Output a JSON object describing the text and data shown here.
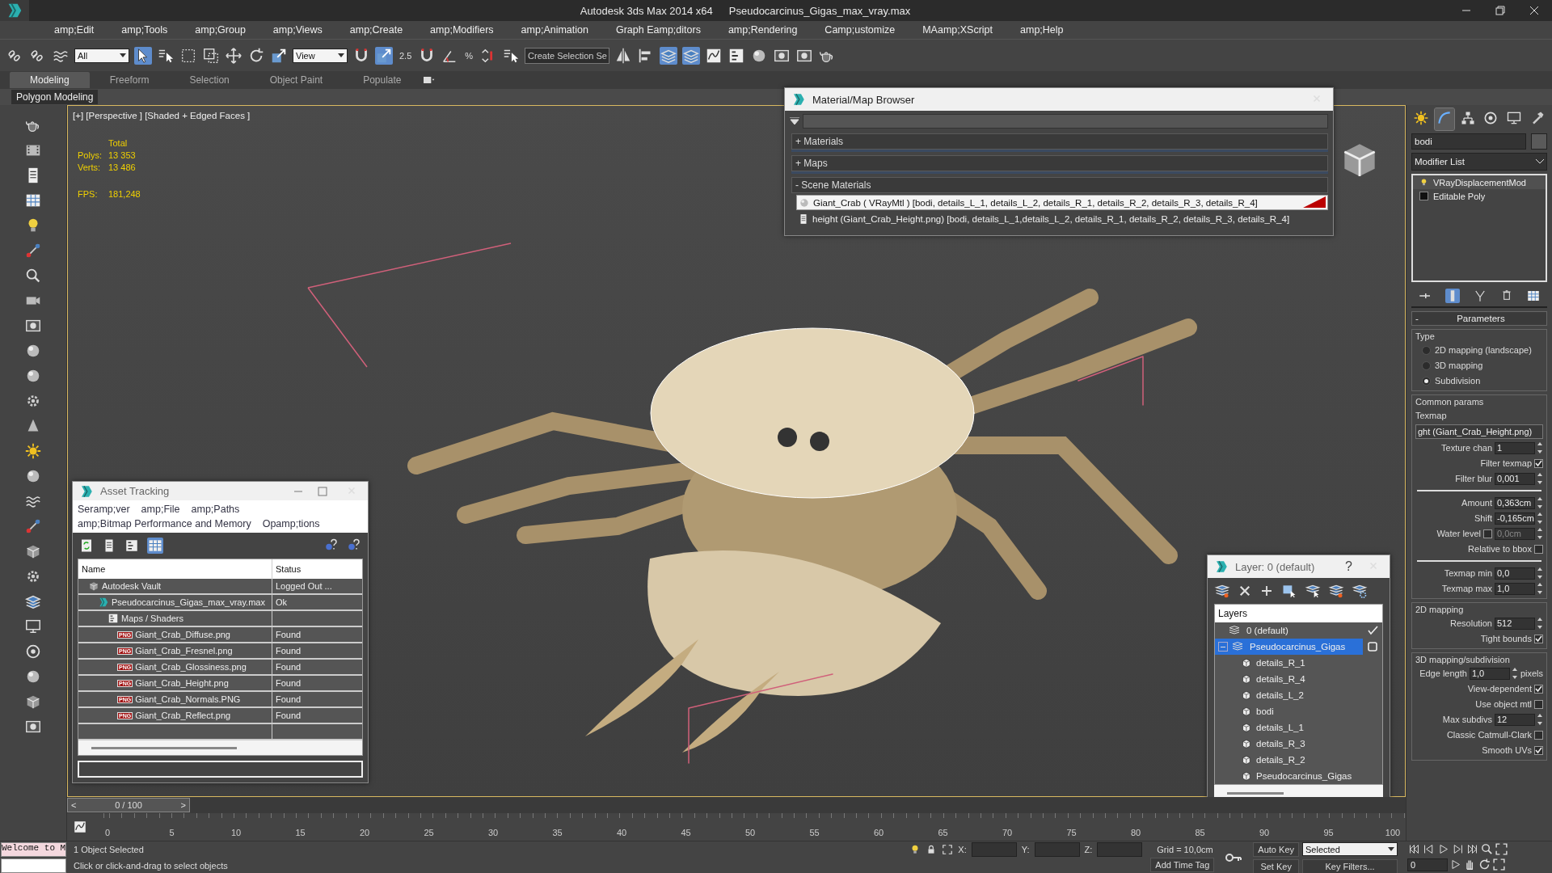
{
  "window": {
    "title": "Autodesk 3ds Max  2014 x64",
    "file": "Pseudocarcinus_Gigas_max_vray.max"
  },
  "menu": [
    "amp;Edit",
    "amp;Tools",
    "amp;Group",
    "amp;Views",
    "amp;Create",
    "amp;Modifiers",
    "amp;Animation",
    "Graph Eamp;ditors",
    "amp;Rendering",
    "Camp;ustomize",
    "MAamp;XScript",
    "amp;Help"
  ],
  "toolbar": {
    "selection_filter": "All",
    "reference_coord": "View",
    "snap_label": "2.5",
    "percent_label": "%",
    "named_selection": "Create Selection Se"
  },
  "ribbon": {
    "tabs": [
      {
        "label": "Modeling",
        "selected": true
      },
      {
        "label": "Freeform",
        "selected": false
      },
      {
        "label": "Selection",
        "selected": false
      },
      {
        "label": "Object Paint",
        "selected": false
      },
      {
        "label": "Populate",
        "selected": false
      }
    ],
    "panel": "Polygon Modeling"
  },
  "viewport": {
    "label": "[+] [Perspective ] [Shaded + Edged Faces ]",
    "stats_heading": "Total",
    "stats": [
      {
        "label": "Polys:",
        "value": "13 353"
      },
      {
        "label": "Verts:",
        "value": "13 486"
      }
    ],
    "fps_label": "FPS:",
    "fps": "181,248"
  },
  "material_browser": {
    "title": "Material/Map Browser",
    "groups": [
      {
        "sign": "+",
        "label": "Materials",
        "expanded": false
      },
      {
        "sign": "+",
        "label": "Maps",
        "expanded": false
      },
      {
        "sign": "-",
        "label": "Scene Materials",
        "expanded": true,
        "items": [
          {
            "kind": "material",
            "label": "Giant_Crab  ( VRayMtl ) [bodi, details_L_1, details_L_2, details_R_1, details_R_2, details_R_3, details_R_4]",
            "selected": true
          },
          {
            "kind": "map",
            "label": "height (Giant_Crab_Height.png) [bodi, details_L_1,details_L_2, details_R_1, details_R_2, details_R_3, details_R_4]",
            "selected": false
          }
        ]
      }
    ]
  },
  "asset_tracking": {
    "title": "Asset Tracking",
    "menu": [
      [
        "Seramp;ver",
        "amp;File",
        "amp;Paths"
      ],
      [
        "amp;Bitmap Performance and Memory",
        "Opamp;tions"
      ]
    ],
    "columns": [
      "Name",
      "Status"
    ],
    "rows": [
      {
        "kind": "vault",
        "name": "Autodesk Vault",
        "status": "Logged Out ...",
        "children": [
          {
            "kind": "scene",
            "name": "Pseudocarcinus_Gigas_max_vray.max",
            "status": "Ok",
            "children": [
              {
                "kind": "folder",
                "name": "Maps / Shaders",
                "children": [
                  {
                    "kind": "bitmap",
                    "badge": "PNG",
                    "name": "Giant_Crab_Diffuse.png",
                    "status": "Found"
                  },
                  {
                    "kind": "bitmap",
                    "badge": "PNG",
                    "name": "Giant_Crab_Fresnel.png",
                    "status": "Found"
                  },
                  {
                    "kind": "bitmap",
                    "badge": "PNG",
                    "name": "Giant_Crab_Glossiness.png",
                    "status": "Found"
                  },
                  {
                    "kind": "bitmap",
                    "badge": "PNG",
                    "name": "Giant_Crab_Height.png",
                    "status": "Found"
                  },
                  {
                    "kind": "bitmap",
                    "badge": "PNG",
                    "name": "Giant_Crab_Normals.PNG",
                    "status": "Found"
                  },
                  {
                    "kind": "bitmap",
                    "badge": "PNG",
                    "name": "Giant_Crab_Reflect.png",
                    "status": "Found"
                  }
                ]
              }
            ]
          }
        ]
      }
    ]
  },
  "layer_manager": {
    "title": "Layer: 0 (default)",
    "help": "?",
    "header": "Layers",
    "layers": [
      {
        "name": "0 (default)",
        "current": true,
        "selected": false
      },
      {
        "name": "Pseudocarcinus_Gigas",
        "current": false,
        "selected": true,
        "expanded": true,
        "children": [
          {
            "name": "details_R_1"
          },
          {
            "name": "details_R_4"
          },
          {
            "name": "details_L_2"
          },
          {
            "name": "bodi"
          },
          {
            "name": "details_L_1"
          },
          {
            "name": "details_R_3"
          },
          {
            "name": "details_R_2"
          },
          {
            "name": "Pseudocarcinus_Gigas"
          }
        ]
      }
    ]
  },
  "command_panel": {
    "tabs": [
      {
        "selected": false
      },
      {
        "selected": true
      },
      {
        "selected": false
      },
      {
        "selected": false
      },
      {
        "selected": false
      },
      {
        "selected": false
      }
    ],
    "object_name": "bodi",
    "modifier_list": "Modifier List",
    "stack": [
      {
        "kind": "modifier",
        "label": "VRayDisplacementMod"
      },
      {
        "kind": "base",
        "label": "Editable Poly"
      }
    ],
    "rollout": {
      "sign": "-",
      "title": "Parameters"
    },
    "groups": [
      {
        "title": "Type",
        "rows": [
          {
            "kind": "radio",
            "label": "2D mapping (landscape)",
            "selected": false
          },
          {
            "kind": "radio",
            "label": "3D mapping",
            "selected": false
          },
          {
            "kind": "radio",
            "label": "Subdivision",
            "selected": true
          }
        ]
      },
      {
        "title": "Common params",
        "rows": [
          {
            "kind": "label",
            "label": "Texmap"
          },
          {
            "kind": "button",
            "label": "ght (Giant_Crab_Height.png)"
          },
          {
            "kind": "spinner",
            "label": "Texture chan",
            "value": "1"
          },
          {
            "kind": "check",
            "label": "Filter texmap",
            "checked": true
          },
          {
            "kind": "spinner",
            "label": "Filter blur",
            "value": "0,001"
          },
          {
            "kind": "separator"
          },
          {
            "kind": "spinner",
            "label": "Amount",
            "value": "0,363cm"
          },
          {
            "kind": "spinner",
            "label": "Shift",
            "value": "-0,165cm"
          },
          {
            "kind": "check_spinner",
            "label": "Water level",
            "checked": false,
            "value": "0,0cm",
            "disabled": true
          },
          {
            "kind": "check",
            "label": "Relative to bbox",
            "checked": false
          },
          {
            "kind": "separator"
          },
          {
            "kind": "spinner",
            "label": "Texmap min",
            "value": "0,0"
          },
          {
            "kind": "spinner",
            "label": "Texmap max",
            "value": "1,0"
          }
        ]
      },
      {
        "title": "2D mapping",
        "rows": [
          {
            "kind": "spinner",
            "label": "Resolution",
            "value": "512"
          },
          {
            "kind": "check",
            "label": "Tight bounds",
            "checked": true
          }
        ]
      },
      {
        "title": "3D mapping/subdivision",
        "rows": [
          {
            "kind": "spinner",
            "label": "Edge length",
            "value": "1,0",
            "unit": "pixels"
          },
          {
            "kind": "check",
            "label": "View-dependent",
            "checked": true
          },
          {
            "kind": "check",
            "label": "Use object mtl",
            "checked": false
          },
          {
            "kind": "spinner",
            "label": "Max subdivs",
            "value": "12"
          },
          {
            "kind": "check",
            "label": "Classic Catmull-Clark",
            "checked": false
          },
          {
            "kind": "check",
            "label": "Smooth UVs",
            "checked": true
          }
        ]
      }
    ]
  },
  "time_slider": {
    "prev": "<",
    "position": "0 / 100",
    "next": ">",
    "level": 0
  },
  "timeline": {
    "ticks": [
      "0",
      "5",
      "10",
      "15",
      "20",
      "25",
      "30",
      "35",
      "40",
      "45",
      "50",
      "55",
      "60",
      "65",
      "70",
      "75",
      "80",
      "85",
      "90",
      "95",
      "100"
    ]
  },
  "status": {
    "listener": "Welcome to M",
    "selection": "1 Object Selected",
    "prompt": "Click or click-and-drag to select objects",
    "x_label": "X:",
    "y_label": "Y:",
    "z_label": "Z:",
    "grid": "Grid = 10,0cm",
    "add_time_tag": "Add Time Tag",
    "auto_key": "Auto Key",
    "key_mode": "Selected",
    "set_key": "Set Key",
    "key_filters": "Key Filters...",
    "frame": "0"
  }
}
